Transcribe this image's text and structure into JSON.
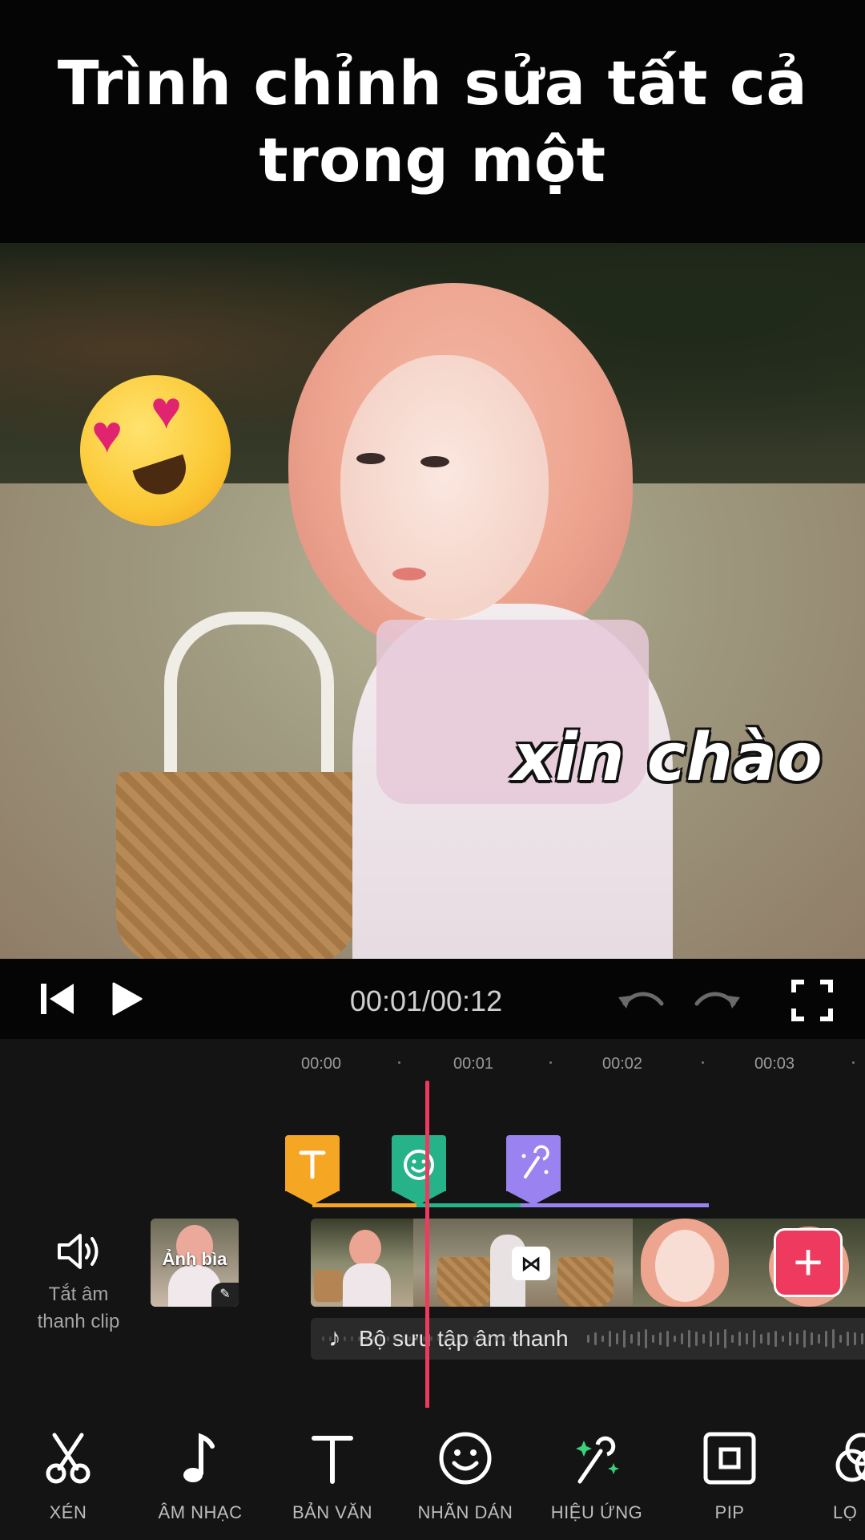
{
  "banner": {
    "line1": "Trình chỉnh sửa tất cả",
    "line2": "trong một"
  },
  "preview": {
    "caption": "xin chào",
    "sticker": "heart-eyes-emoji"
  },
  "playback": {
    "timecode": "00:01/00:12"
  },
  "ruler": {
    "t0": "00:00",
    "t1": "00:01",
    "t2": "00:02",
    "t3": "00:03"
  },
  "timeline": {
    "mute_label_1": "Tắt âm",
    "mute_label_2": "thanh clip",
    "cover_label": "Ảnh bìa",
    "audio_label": "Bộ sưu tập âm thanh",
    "add_symbol": "+",
    "transition_symbol": "⋈"
  },
  "markers": {
    "text_color": "#f5a623",
    "sticker_color": "#27b38a",
    "effect_color": "#9a83f0"
  },
  "toolbar": {
    "cut": "XÉN",
    "music": "ÂM NHẠC",
    "text": "BẢN VĂN",
    "sticker": "NHÃN DÁN",
    "effect": "HIỆU ỨNG",
    "pip": "PIP",
    "filter": "LỌ"
  },
  "colors": {
    "accent": "#ee3a5e",
    "background": "#141414"
  }
}
